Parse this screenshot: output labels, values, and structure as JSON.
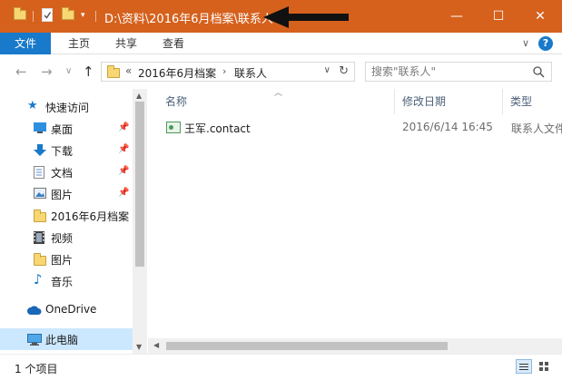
{
  "window": {
    "title": "D:\\资料\\2016年6月档案\\联系人",
    "minimize": "—",
    "maximize": "☐",
    "close": "✕"
  },
  "ribbon": {
    "tabs": [
      "文件",
      "主页",
      "共享",
      "查看"
    ],
    "expand": "∨",
    "help": "?"
  },
  "address": {
    "prefix": "«",
    "crumbs": [
      "2016年6月档案",
      "联系人"
    ],
    "separator": "›",
    "dropdown": "∨",
    "refresh": "↻"
  },
  "search": {
    "placeholder": "搜索\"联系人\""
  },
  "nav": {
    "back": "←",
    "forward": "→",
    "history": "∨",
    "up": "↑",
    "pin": "📌",
    "items": [
      {
        "label": "快速访问",
        "icon": "star-icon"
      },
      {
        "label": "桌面",
        "icon": "desktop-icon",
        "pinned": true
      },
      {
        "label": "下载",
        "icon": "download-icon",
        "pinned": true
      },
      {
        "label": "文档",
        "icon": "document-icon",
        "pinned": true
      },
      {
        "label": "图片",
        "icon": "picture-icon",
        "pinned": true
      },
      {
        "label": "2016年6月档案",
        "icon": "folder-icon"
      },
      {
        "label": "视频",
        "icon": "video-icon"
      },
      {
        "label": "图片",
        "icon": "folder-icon"
      },
      {
        "label": "音乐",
        "icon": "music-icon"
      },
      {
        "label": "OneDrive",
        "icon": "cloud-icon"
      },
      {
        "label": "此电脑",
        "icon": "computer-icon"
      }
    ]
  },
  "columns": {
    "name": "名称",
    "modified": "修改日期",
    "type": "类型"
  },
  "files": [
    {
      "name": "王军.contact",
      "modified": "2016/6/14 16:45",
      "type": "联系人文件"
    }
  ],
  "status": {
    "count": "1 个项目"
  },
  "colors": {
    "titlebar": "#d5611d",
    "accent": "#1979ca",
    "selection": "#cce8ff"
  }
}
